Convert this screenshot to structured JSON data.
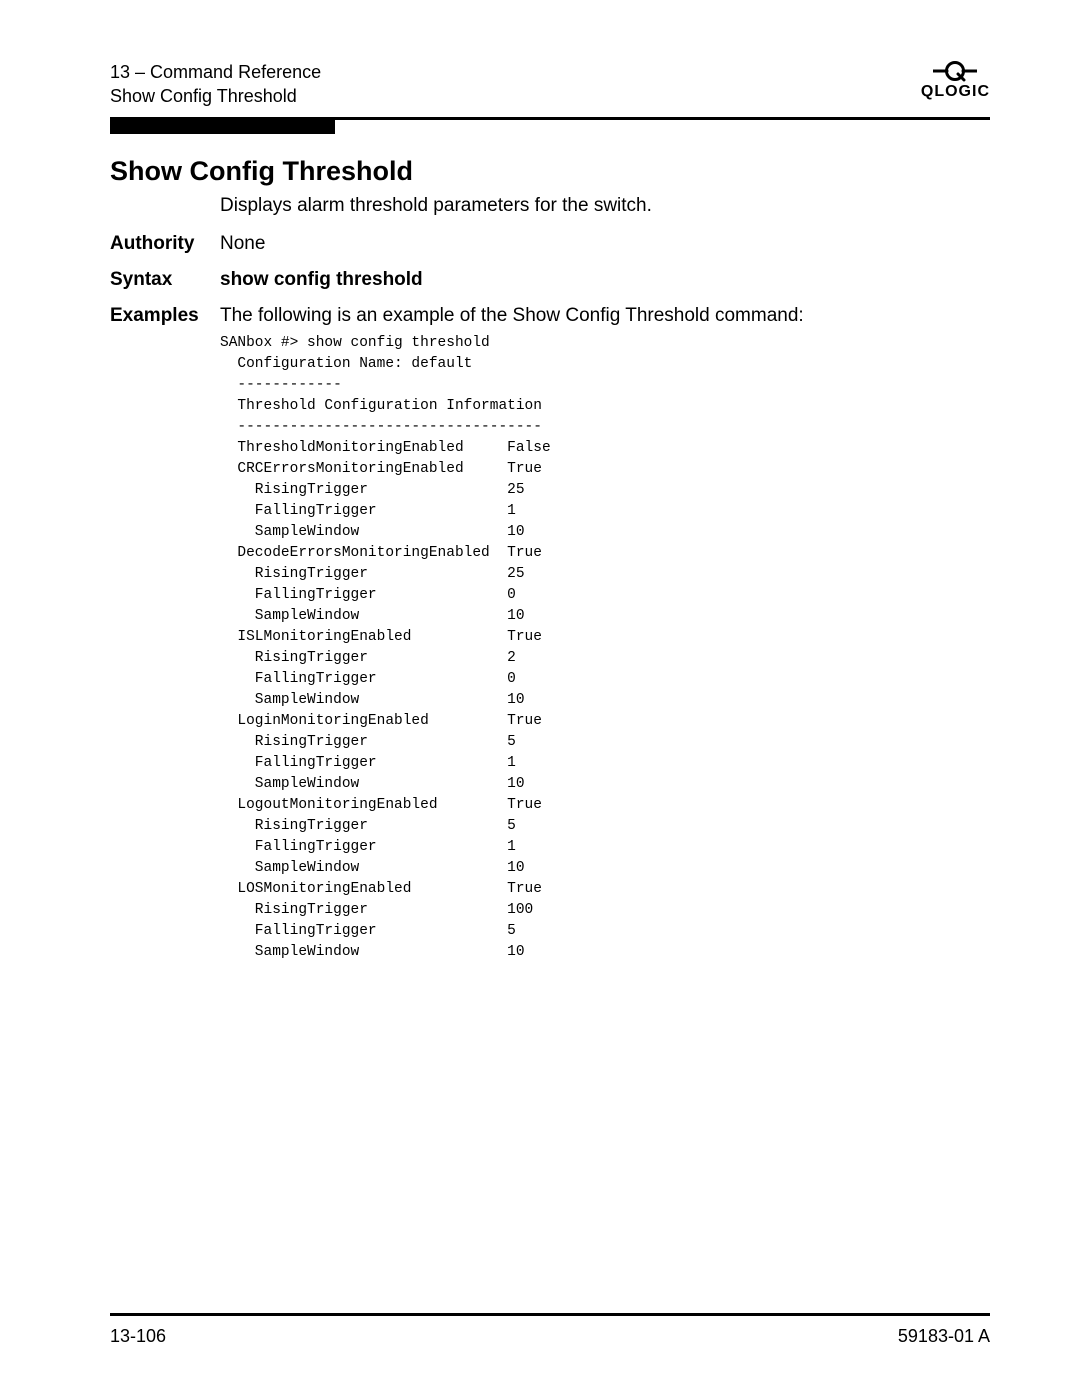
{
  "header": {
    "chapter": "13 – Command Reference",
    "subtitle": "Show Config Threshold",
    "logo_text": "QLOGIC"
  },
  "title": "Show Config Threshold",
  "description": "Displays alarm threshold parameters for the switch.",
  "authority": {
    "label": "Authority",
    "value": "None"
  },
  "syntax": {
    "label": "Syntax",
    "value": "show config threshold"
  },
  "examples": {
    "label": "Examples",
    "intro": "The following is an example of the Show Config Threshold command:",
    "code": "SANbox #> show config threshold\n  Configuration Name: default\n  ------------\n  Threshold Configuration Information\n  -----------------------------------\n  ThresholdMonitoringEnabled     False\n  CRCErrorsMonitoringEnabled     True\n    RisingTrigger                25\n    FallingTrigger               1\n    SampleWindow                 10\n  DecodeErrorsMonitoringEnabled  True\n    RisingTrigger                25\n    FallingTrigger               0\n    SampleWindow                 10\n  ISLMonitoringEnabled           True\n    RisingTrigger                2\n    FallingTrigger               0\n    SampleWindow                 10\n  LoginMonitoringEnabled         True\n    RisingTrigger                5\n    FallingTrigger               1\n    SampleWindow                 10\n  LogoutMonitoringEnabled        True\n    RisingTrigger                5\n    FallingTrigger               1\n    SampleWindow                 10\n  LOSMonitoringEnabled           True\n    RisingTrigger                100\n    FallingTrigger               5\n    SampleWindow                 10"
  },
  "footer": {
    "left": "13-106",
    "right": "59183-01 A"
  }
}
